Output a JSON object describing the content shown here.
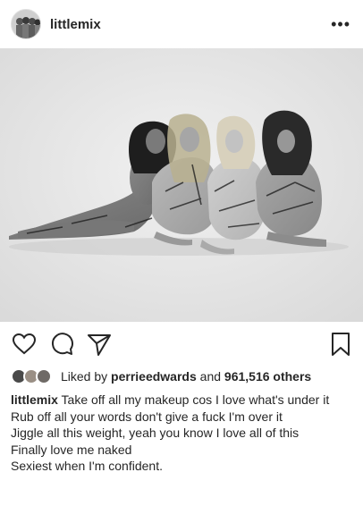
{
  "post": {
    "username": "littlemix",
    "more_label": "•••"
  },
  "likes": {
    "prefix": "Liked by",
    "liker": "perrieedwards",
    "conjunction": "and",
    "count_text": "961,516 others"
  },
  "caption": {
    "username": "littlemix",
    "first_line": "Take off all my makeup cos I love what's under it",
    "lines": [
      "Rub off all your words don't give a fuck I'm over it",
      "Jiggle all this weight, yeah you know I love all of this",
      "Finally love me naked",
      "Sexiest when I'm confident."
    ]
  },
  "icons": {
    "like": "heart-icon",
    "comment": "comment-icon",
    "share": "paper-plane-icon",
    "save": "bookmark-icon"
  },
  "colors": {
    "text": "#262626",
    "photo_background": "#e7e7e7"
  }
}
